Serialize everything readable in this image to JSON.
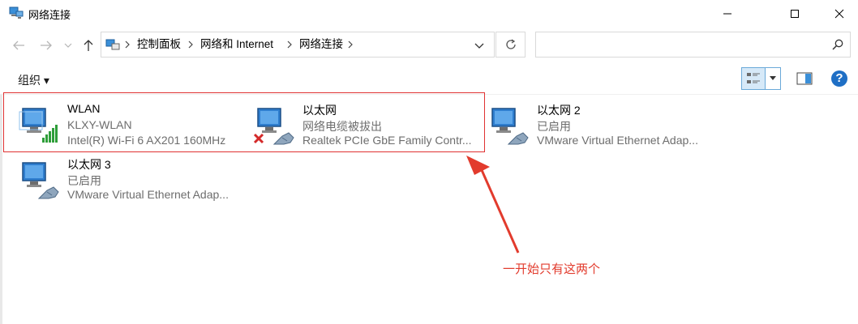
{
  "window": {
    "title": "网络连接",
    "controls": [
      "minimize-icon",
      "maximize-icon",
      "close-icon"
    ]
  },
  "address": {
    "breadcrumb": [
      "控制面板",
      "网络和 Internet",
      "网络连接"
    ],
    "search_placeholder": ""
  },
  "toolbar": {
    "organize_label": "组织 ▾",
    "help_label": "?"
  },
  "connections": [
    {
      "name": "WLAN",
      "status": "KLXY-WLAN",
      "device": "Intel(R) Wi-Fi 6 AX201 160MHz",
      "icon": "wifi-adapter-icon"
    },
    {
      "name": "以太网",
      "status": "网络电缆被拔出",
      "device": "Realtek PCIe GbE Family Contr...",
      "icon": "ethernet-disconnected-icon"
    },
    {
      "name": "以太网 2",
      "status": "已启用",
      "device": "VMware Virtual Ethernet Adap...",
      "icon": "ethernet-adapter-icon"
    },
    {
      "name": "以太网 3",
      "status": "已启用",
      "device": "VMware Virtual Ethernet Adap...",
      "icon": "ethernet-adapter-icon"
    }
  ],
  "annotation": {
    "text": "一开始只有这两个",
    "color": "#e23b2d"
  },
  "colors": {
    "accent": "#1f6fc5",
    "highlight_border": "#e03232",
    "secondary_text": "#6d6d6d"
  }
}
